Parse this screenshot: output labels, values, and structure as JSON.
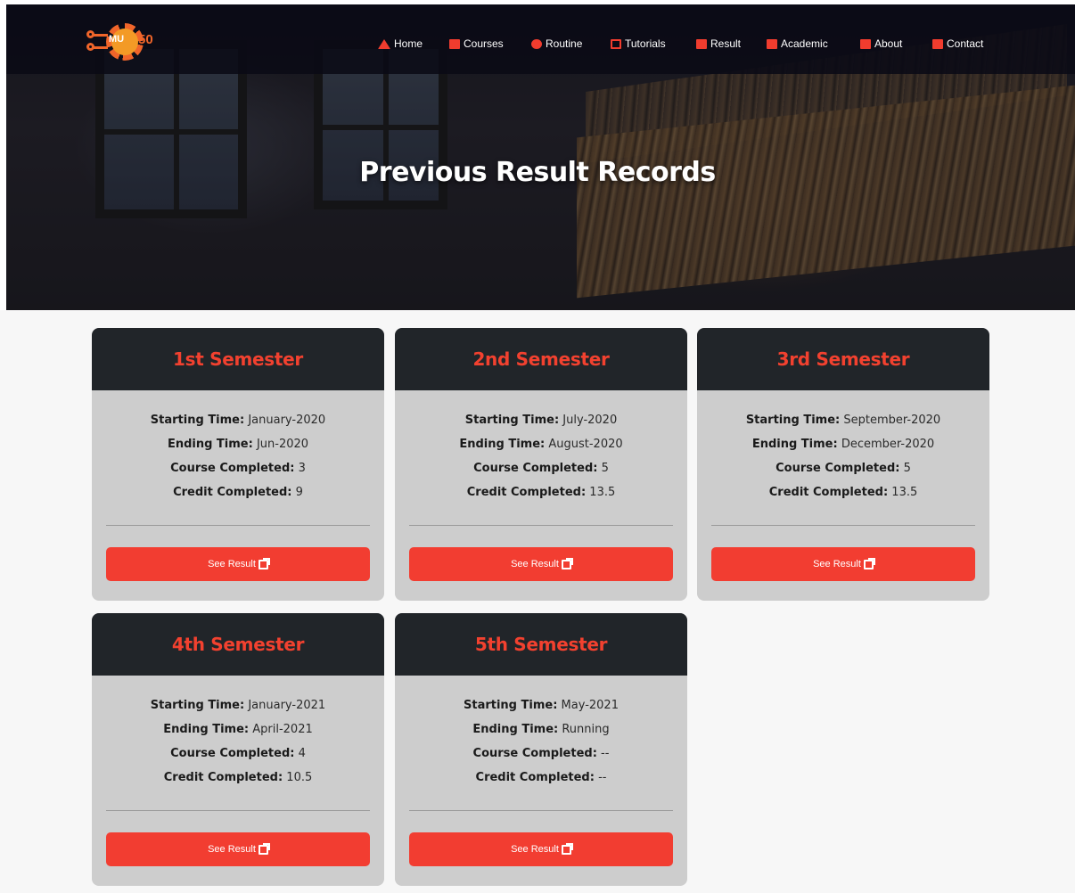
{
  "nav": {
    "logo_text_left": "MU",
    "logo_text_right": "50",
    "items": [
      {
        "label": "Home",
        "icon": "home-icon"
      },
      {
        "label": "Courses",
        "icon": "book-icon"
      },
      {
        "label": "Routine",
        "icon": "clock-icon"
      },
      {
        "label": "Tutorials",
        "icon": "chalkboard-icon"
      },
      {
        "label": "Result",
        "icon": "poll-icon"
      },
      {
        "label": "Academic",
        "icon": "university-icon"
      },
      {
        "label": "About",
        "icon": "id-card-icon"
      },
      {
        "label": "Contact",
        "icon": "address-book-icon"
      }
    ]
  },
  "hero": {
    "title": "Previous Result Records"
  },
  "labels": {
    "starting": "Starting Time:",
    "ending": "Ending Time:",
    "course": "Course Completed:",
    "credit": "Credit Completed:",
    "button": "See Result"
  },
  "semesters": [
    {
      "title": "1st Semester",
      "start": "January-2020",
      "end": "Jun-2020",
      "courses": "3",
      "credits": "9"
    },
    {
      "title": "2nd Semester",
      "start": "July-2020",
      "end": "August-2020",
      "courses": "5",
      "credits": "13.5"
    },
    {
      "title": "3rd Semester",
      "start": "September-2020",
      "end": "December-2020",
      "courses": "5",
      "credits": "13.5"
    },
    {
      "title": "4th Semester",
      "start": "January-2021",
      "end": "April-2021",
      "courses": "4",
      "credits": "10.5"
    },
    {
      "title": "5th Semester",
      "start": "May-2021",
      "end": "Running",
      "courses": "--",
      "credits": "--"
    }
  ],
  "colors": {
    "accent": "#f23d31",
    "card_head": "#212529",
    "card_body": "#cdcdcd"
  }
}
